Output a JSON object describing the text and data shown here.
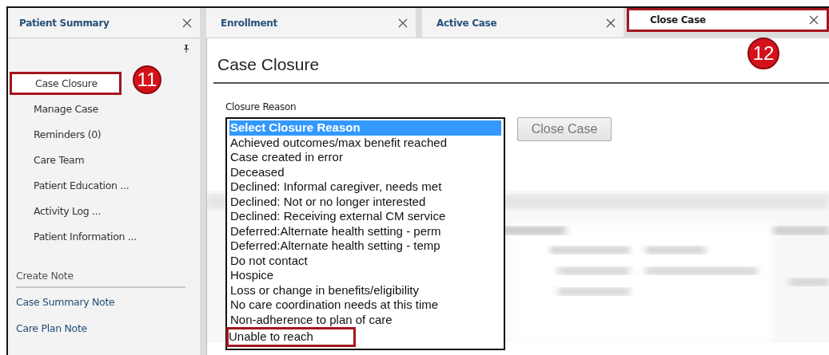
{
  "tabs": [
    {
      "label": "Patient Summary",
      "selected": false,
      "highlighted": false
    },
    {
      "label": "Enrollment",
      "selected": false,
      "highlighted": false
    },
    {
      "label": "Active Case",
      "selected": false,
      "highlighted": false
    },
    {
      "label": "Close Case",
      "selected": true,
      "highlighted": true,
      "callout": "12"
    }
  ],
  "sidebar": {
    "items": [
      {
        "label": "Case Closure",
        "highlighted": true,
        "callout": "11"
      },
      {
        "label": "Manage Case",
        "highlighted": false
      },
      {
        "label": "Reminders (0)",
        "highlighted": false
      },
      {
        "label": "Care Team",
        "highlighted": false
      },
      {
        "label": "Patient Education ...",
        "highlighted": false
      },
      {
        "label": "Activity Log ...",
        "highlighted": false
      },
      {
        "label": "Patient Information ...",
        "highlighted": false
      }
    ],
    "section_title": "Create Note",
    "links": [
      "Case Summary Note",
      "Care Plan Note"
    ]
  },
  "main": {
    "title": "Case Closure",
    "field_label": "Closure Reason",
    "options": [
      {
        "label": "Select Closure Reason",
        "selected": true,
        "highlighted": false
      },
      {
        "label": "Achieved outcomes/max benefit reached",
        "selected": false,
        "highlighted": false
      },
      {
        "label": "Case created in error",
        "selected": false,
        "highlighted": false
      },
      {
        "label": "Deceased",
        "selected": false,
        "highlighted": false
      },
      {
        "label": "Declined: Informal caregiver, needs met",
        "selected": false,
        "highlighted": false
      },
      {
        "label": "Declined: Not or no longer interested",
        "selected": false,
        "highlighted": false
      },
      {
        "label": "Declined: Receiving external CM service",
        "selected": false,
        "highlighted": false
      },
      {
        "label": "Deferred:Alternate health setting - perm",
        "selected": false,
        "highlighted": false
      },
      {
        "label": "Deferred:Alternate health setting - temp",
        "selected": false,
        "highlighted": false
      },
      {
        "label": "Do not contact",
        "selected": false,
        "highlighted": false
      },
      {
        "label": "Hospice",
        "selected": false,
        "highlighted": false
      },
      {
        "label": "Loss or change in benefits/eligibility",
        "selected": false,
        "highlighted": false
      },
      {
        "label": "No care coordination needs at this time",
        "selected": false,
        "highlighted": false
      },
      {
        "label": "Non-adherence to plan of care",
        "selected": false,
        "highlighted": false
      },
      {
        "label": "Unable to reach",
        "selected": false,
        "highlighted": true
      }
    ],
    "button": "Close Case"
  }
}
